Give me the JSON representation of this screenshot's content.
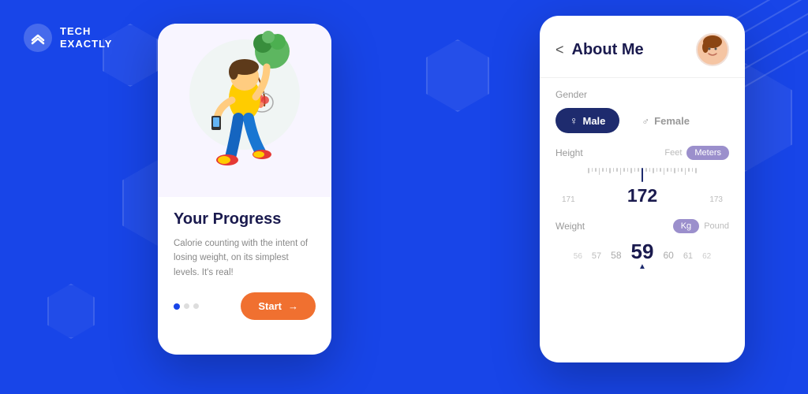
{
  "brand": {
    "name_line1": "TECH",
    "name_line2": "Exactly",
    "logo_alt": "Tech Exactly Logo"
  },
  "background": {
    "color": "#1845e8"
  },
  "phone1": {
    "title": "Your Progress",
    "subtitle": "Calorie counting with the intent of losing weight, on its simplest levels. It's real!",
    "start_button": "Start",
    "dots": [
      {
        "active": true
      },
      {
        "active": false
      },
      {
        "active": false
      }
    ]
  },
  "phone2": {
    "page_title": "About Me",
    "back_label": "<",
    "gender_label": "Gender",
    "gender_options": [
      {
        "label": "Male",
        "icon": "♀",
        "active": true
      },
      {
        "label": "Female",
        "icon": "♂",
        "active": false
      }
    ],
    "height_label": "Height",
    "height_unit_inactive": "Feet",
    "height_unit_active": "Meters",
    "height_values": {
      "left2": "171",
      "left1": "",
      "center": "172",
      "right1": "",
      "right2": "173"
    },
    "weight_label": "Weight",
    "weight_unit_active": "Kg",
    "weight_unit_inactive": "Pound",
    "weight_values": {
      "v1": "56",
      "v2": "57",
      "v3": "58",
      "v4": "59",
      "v5": "60",
      "v6": "61",
      "v7": "62"
    },
    "weight_active": "59"
  }
}
